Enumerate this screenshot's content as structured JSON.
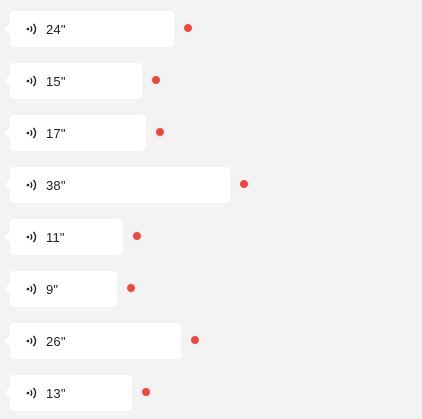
{
  "theme": {
    "background": "#f3f3f3",
    "bubble": "#ffffff",
    "text": "#222222",
    "unread_dot": "#f2463c"
  },
  "voice_messages": [
    {
      "duration": "24\"",
      "icon": "voice-wave-icon",
      "unread": true
    },
    {
      "duration": "15\"",
      "icon": "voice-wave-icon",
      "unread": true
    },
    {
      "duration": "17\"",
      "icon": "voice-wave-icon",
      "unread": true
    },
    {
      "duration": "38\"",
      "icon": "voice-wave-icon",
      "unread": true
    },
    {
      "duration": "11\"",
      "icon": "voice-wave-icon",
      "unread": true
    },
    {
      "duration": "9\"",
      "icon": "voice-wave-icon",
      "unread": true
    },
    {
      "duration": "26\"",
      "icon": "voice-wave-icon",
      "unread": true
    },
    {
      "duration": "13\"",
      "icon": "voice-wave-icon",
      "unread": true
    }
  ]
}
